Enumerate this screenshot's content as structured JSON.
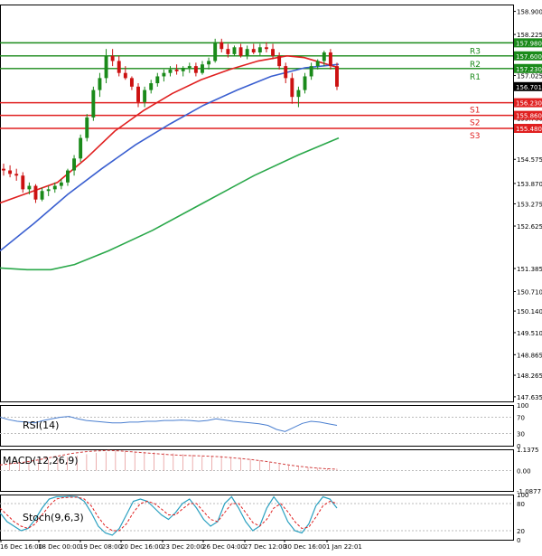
{
  "chart_data": {
    "type": "candlestick",
    "main": {
      "yticks": [
        "158.900",
        "158.225",
        "157.025",
        "155.780",
        "154.575",
        "153.870",
        "153.275",
        "152.625",
        "151.385",
        "150.710",
        "150.140",
        "149.510",
        "148.865",
        "148.265",
        "147.635"
      ],
      "price_labels": [
        {
          "text": "157.980",
          "value": 157.98,
          "color": "#1a8a1a"
        },
        {
          "text": "157.600",
          "value": 157.6,
          "color": "#1a8a1a"
        },
        {
          "text": "157.230",
          "value": 157.23,
          "color": "#1a8a1a"
        },
        {
          "text": "156.701",
          "value": 156.701,
          "color": "#000000"
        },
        {
          "text": "156.230",
          "value": 156.23,
          "color": "#e02020"
        },
        {
          "text": "155.860",
          "value": 155.86,
          "color": "#e02020"
        },
        {
          "text": "155.480",
          "value": 155.48,
          "color": "#e02020"
        }
      ],
      "levels": [
        {
          "label": "R3",
          "value": 157.98,
          "color": "#1a8a1a"
        },
        {
          "label": "R2",
          "value": 157.6,
          "color": "#1a8a1a"
        },
        {
          "label": "R1",
          "value": 157.23,
          "color": "#1a8a1a"
        },
        {
          "label": "S1",
          "value": 156.23,
          "color": "#e02020"
        },
        {
          "label": "S2",
          "value": 155.86,
          "color": "#e02020"
        },
        {
          "label": "S3",
          "value": 155.48,
          "color": "#e02020"
        }
      ],
      "candles": [
        [
          154.3,
          154.45,
          154.1,
          154.25
        ],
        [
          154.25,
          154.4,
          154.05,
          154.15
        ],
        [
          154.15,
          154.3,
          153.95,
          154.1
        ],
        [
          154.1,
          154.2,
          153.6,
          153.7
        ],
        [
          153.7,
          153.9,
          153.55,
          153.8
        ],
        [
          153.8,
          153.85,
          153.3,
          153.4
        ],
        [
          153.4,
          153.75,
          153.35,
          153.65
        ],
        [
          153.65,
          153.8,
          153.5,
          153.7
        ],
        [
          153.7,
          153.9,
          153.6,
          153.8
        ],
        [
          153.8,
          154.0,
          153.7,
          153.9
        ],
        [
          153.9,
          154.3,
          153.8,
          154.25
        ],
        [
          154.25,
          154.7,
          154.1,
          154.6
        ],
        [
          154.6,
          155.3,
          154.5,
          155.2
        ],
        [
          155.2,
          155.9,
          155.1,
          155.8
        ],
        [
          155.8,
          156.7,
          155.7,
          156.6
        ],
        [
          156.6,
          157.1,
          156.4,
          156.95
        ],
        [
          156.95,
          157.8,
          156.8,
          157.6
        ],
        [
          157.6,
          157.8,
          157.3,
          157.45
        ],
        [
          157.45,
          157.6,
          157.0,
          157.1
        ],
        [
          157.1,
          157.3,
          156.9,
          156.95
        ],
        [
          156.95,
          157.0,
          156.6,
          156.7
        ],
        [
          156.7,
          156.8,
          156.1,
          156.25
        ],
        [
          156.25,
          156.7,
          156.1,
          156.6
        ],
        [
          156.6,
          156.9,
          156.5,
          156.8
        ],
        [
          156.8,
          157.1,
          156.7,
          157.0
        ],
        [
          157.0,
          157.2,
          156.85,
          157.1
        ],
        [
          157.1,
          157.3,
          157.0,
          157.2
        ],
        [
          157.2,
          157.35,
          157.05,
          157.15
        ],
        [
          157.15,
          157.3,
          157.0,
          157.25
        ],
        [
          157.25,
          157.4,
          157.1,
          157.3
        ],
        [
          157.3,
          157.4,
          157.0,
          157.1
        ],
        [
          157.1,
          157.45,
          157.05,
          157.35
        ],
        [
          157.35,
          157.55,
          157.2,
          157.45
        ],
        [
          157.45,
          158.1,
          157.4,
          158.0
        ],
        [
          158.0,
          158.1,
          157.7,
          157.8
        ],
        [
          157.8,
          157.95,
          157.55,
          157.65
        ],
        [
          157.65,
          157.9,
          157.6,
          157.85
        ],
        [
          157.85,
          157.95,
          157.55,
          157.6
        ],
        [
          157.6,
          157.9,
          157.5,
          157.8
        ],
        [
          157.8,
          157.95,
          157.65,
          157.7
        ],
        [
          157.7,
          157.95,
          157.6,
          157.85
        ],
        [
          157.85,
          158.0,
          157.7,
          157.8
        ],
        [
          157.8,
          157.95,
          157.5,
          157.6
        ],
        [
          157.6,
          157.7,
          157.2,
          157.3
        ],
        [
          157.3,
          157.4,
          156.8,
          156.95
        ],
        [
          156.95,
          157.1,
          156.2,
          156.4
        ],
        [
          156.4,
          156.7,
          156.1,
          156.6
        ],
        [
          156.6,
          157.1,
          156.5,
          157.0
        ],
        [
          157.0,
          157.4,
          156.9,
          157.3
        ],
        [
          157.3,
          157.5,
          157.2,
          157.45
        ],
        [
          157.45,
          157.75,
          157.3,
          157.7
        ],
        [
          157.7,
          157.8,
          157.2,
          157.3
        ],
        [
          157.3,
          157.4,
          156.6,
          156.7
        ]
      ],
      "ma_red": [
        [
          0,
          153.3
        ],
        [
          5,
          153.6
        ],
        [
          10,
          153.9
        ],
        [
          15,
          154.6
        ],
        [
          20,
          155.4
        ],
        [
          25,
          156.0
        ],
        [
          30,
          156.5
        ],
        [
          35,
          156.9
        ],
        [
          40,
          157.2
        ],
        [
          45,
          157.45
        ],
        [
          50,
          157.6
        ],
        [
          53,
          157.55
        ],
        [
          56,
          157.4
        ],
        [
          59,
          157.25
        ]
      ],
      "ma_blue": [
        [
          0,
          151.9
        ],
        [
          10,
          152.7
        ],
        [
          20,
          153.55
        ],
        [
          30,
          154.3
        ],
        [
          40,
          155.0
        ],
        [
          50,
          155.6
        ],
        [
          60,
          156.15
        ],
        [
          70,
          156.6
        ],
        [
          80,
          157.0
        ],
        [
          90,
          157.25
        ],
        [
          100,
          157.35
        ]
      ],
      "ma_green": [
        [
          0,
          151.4
        ],
        [
          8,
          151.35
        ],
        [
          15,
          151.35
        ],
        [
          22,
          151.5
        ],
        [
          32,
          151.9
        ],
        [
          45,
          152.5
        ],
        [
          60,
          153.3
        ],
        [
          75,
          154.1
        ],
        [
          88,
          154.7
        ],
        [
          100,
          155.2
        ]
      ]
    },
    "rsi": {
      "label": "RSI(14)",
      "yticks": [
        "100",
        "70",
        "30",
        "0"
      ],
      "values": [
        70,
        64,
        60,
        58,
        56,
        62,
        66,
        70,
        72,
        66,
        62,
        60,
        58,
        56,
        56,
        58,
        58,
        60,
        60,
        62,
        62,
        63,
        62,
        60,
        62,
        66,
        63,
        60,
        58,
        56,
        54,
        50,
        40,
        35,
        45,
        55,
        60,
        58,
        54,
        50
      ]
    },
    "macd": {
      "label": "MACD(12,26,9)",
      "yticks": [
        "1.1375",
        "0.00",
        "-1.0877"
      ],
      "histogram": [
        0.35,
        0.4,
        0.45,
        0.5,
        0.55,
        0.6,
        0.65,
        0.72,
        0.8,
        0.88,
        0.95,
        1.0,
        1.05,
        1.05,
        1.02,
        1.0,
        0.98,
        0.95,
        0.92,
        0.88,
        0.85,
        0.82,
        0.8,
        0.78,
        0.72,
        0.68,
        0.62,
        0.55,
        0.45,
        0.35,
        0.28,
        0.22,
        0.18,
        0.15,
        0.12,
        0.1
      ],
      "signal": [
        0.3,
        0.38,
        0.45,
        0.55,
        0.68,
        0.8,
        0.92,
        1.0,
        1.05,
        1.08,
        1.05,
        1.0,
        0.95,
        0.9,
        0.85,
        0.82,
        0.8,
        0.78,
        0.75,
        0.7,
        0.65,
        0.58,
        0.5,
        0.4,
        0.3,
        0.22,
        0.15,
        0.1,
        0.08
      ]
    },
    "stoch": {
      "label": "Stoch(9,6,3)",
      "yticks": [
        "100",
        "80",
        "20",
        "0"
      ],
      "main": [
        60,
        40,
        30,
        20,
        25,
        45,
        70,
        90,
        95,
        95,
        96,
        95,
        85,
        60,
        30,
        15,
        10,
        25,
        55,
        85,
        90,
        85,
        70,
        55,
        45,
        60,
        80,
        90,
        70,
        45,
        30,
        40,
        80,
        95,
        70,
        40,
        20,
        30,
        70,
        95,
        75,
        40,
        20,
        15,
        35,
        75,
        95,
        90,
        70
      ],
      "signal": [
        70,
        55,
        40,
        30,
        25,
        35,
        55,
        75,
        90,
        93,
        94,
        94,
        90,
        75,
        50,
        30,
        20,
        20,
        35,
        60,
        80,
        85,
        80,
        68,
        55,
        55,
        68,
        80,
        80,
        62,
        45,
        40,
        60,
        80,
        80,
        60,
        38,
        30,
        45,
        70,
        80,
        62,
        40,
        25,
        28,
        50,
        75,
        85,
        80
      ]
    },
    "x_labels": [
      "16 Dec 16:00",
      "18 Dec 00:00",
      "19 Dec 08:00",
      "20 Dec 16:00",
      "23 Dec 20:00",
      "26 Dec 04:00",
      "27 Dec 12:00",
      "30 Dec 16:00",
      "1 Jan 22:01"
    ],
    "colors": {
      "bull": "#1a8a1a",
      "bear": "#cc1111",
      "ma_red": "#e02020",
      "ma_blue": "#3a5fd0",
      "ma_green": "#2aa84a",
      "rsi": "#4a7fd0",
      "macd_hist": "#d24040",
      "macd_signal": "#d24040",
      "stoch_main": "#2aa0c0",
      "stoch_signal": "#e02020"
    }
  }
}
